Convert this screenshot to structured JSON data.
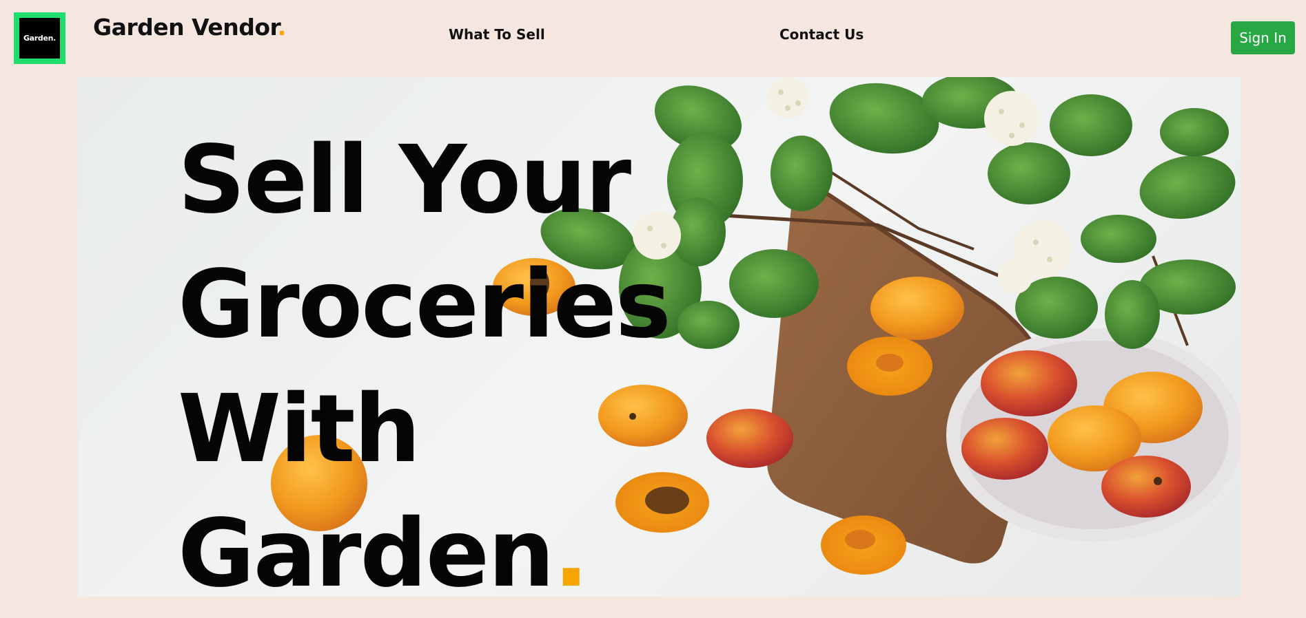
{
  "header": {
    "logo_text": "Garden.",
    "brand_name": "Garden Vendor",
    "brand_dot": ".",
    "nav": [
      {
        "label": "What To Sell"
      },
      {
        "label": "Contact Us"
      }
    ],
    "signin_label": "Sign In"
  },
  "hero": {
    "lines": [
      "Sell Your",
      "Groceries",
      "With",
      "Garden"
    ],
    "dot": ".",
    "image_icon": "apricots-leaves-image"
  },
  "colors": {
    "background": "#f6e6e0",
    "logo_accent": "#1fde6d",
    "brand_dot": "#f5a400",
    "signin_button": "#27a844"
  }
}
